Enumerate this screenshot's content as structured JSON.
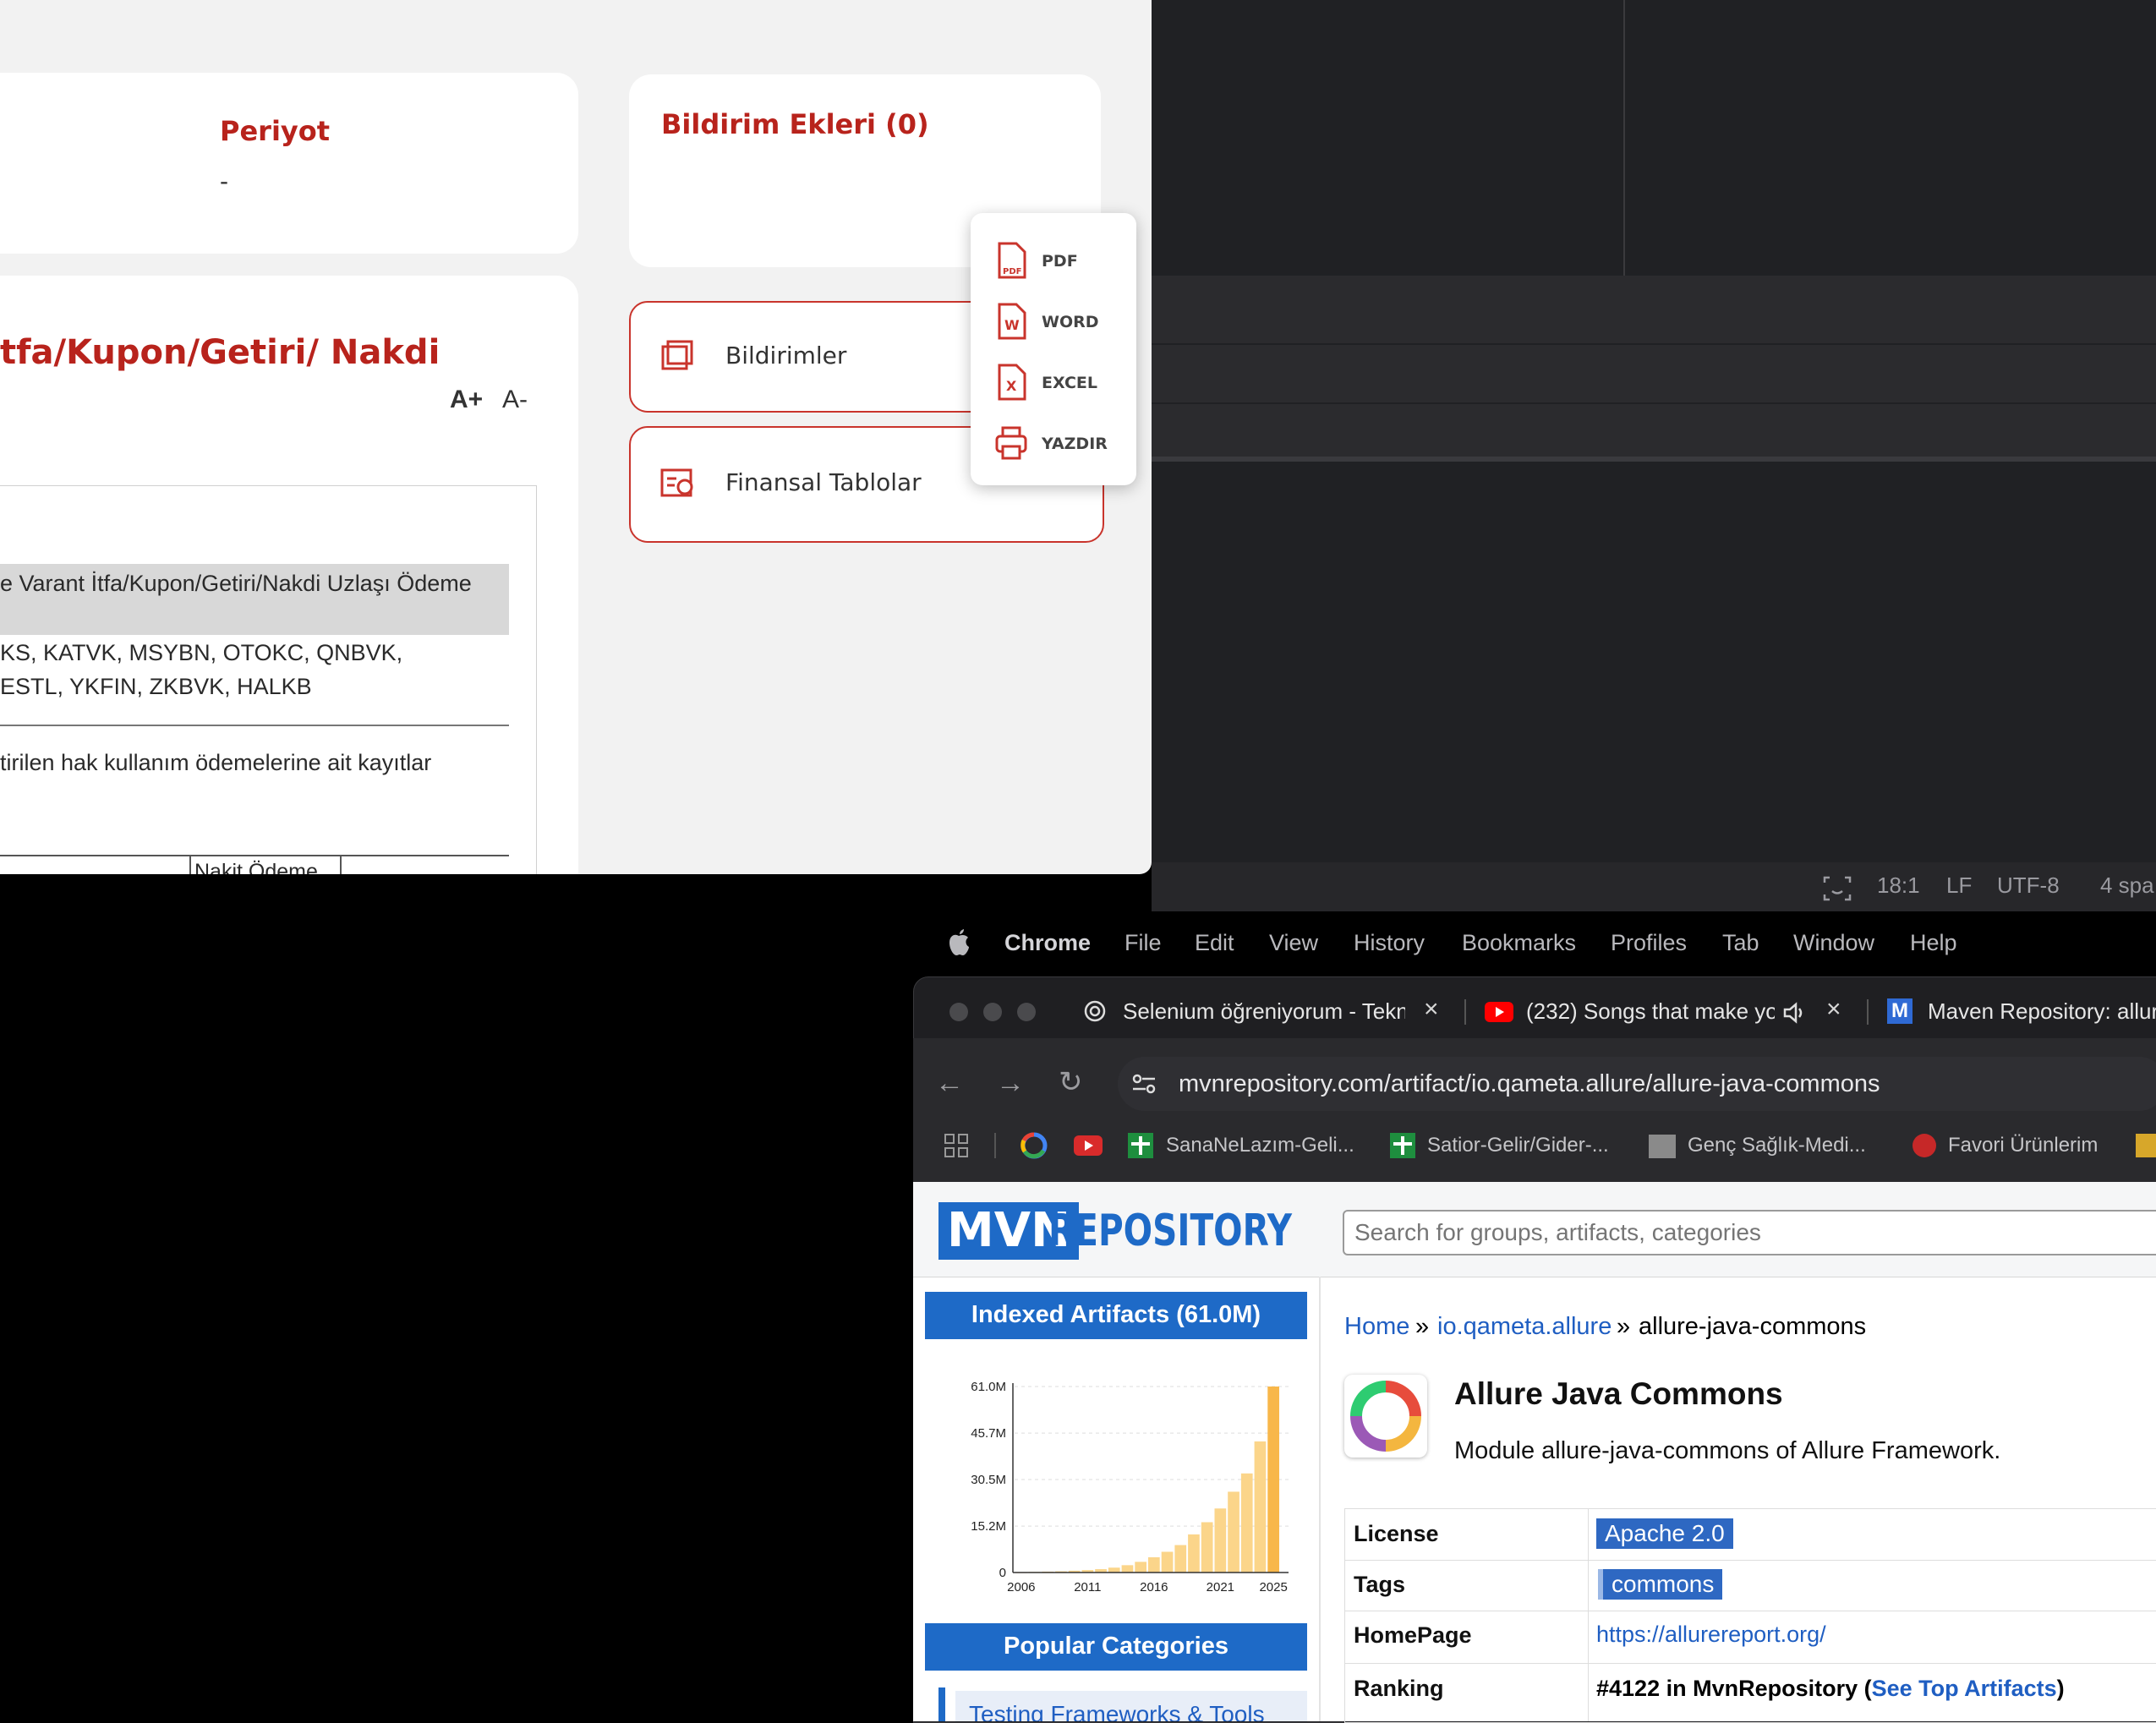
{
  "kap": {
    "period_title": "Periyot",
    "period_value": "-",
    "attachments_title": "Bildirim Ekleri (0)",
    "section_title": "tfa/Kupon/Getiri/ Nakdi",
    "font_plus": "A+",
    "font_minus": "A-",
    "notifications_btn": "Bildirimler",
    "financials_btn": "Finansal Tablolar",
    "doc_line1": "e Varant İtfa/Kupon/Getiri/Nakdi Uzlaşı Ödeme",
    "doc_line2": "KS, KATVK, MSYBN, OTOKC, QNBVK,",
    "doc_line3": "ESTL, YKFIN, ZKBVK, HALKB",
    "doc_line4": "tirilen hak kullanım ödemelerine ait kayıtlar",
    "doc_table_header": "Nakit Ödeme",
    "export": [
      "PDF",
      "WORD",
      "EXCEL",
      "YAZDIR"
    ],
    "accent": "#b8231c"
  },
  "editor_status": {
    "position": "18:1",
    "line_ending": "LF",
    "encoding": "UTF-8",
    "indent": "4 spa"
  },
  "menubar": [
    "Chrome",
    "File",
    "Edit",
    "View",
    "History",
    "Bookmarks",
    "Profiles",
    "Tab",
    "Window",
    "Help"
  ],
  "chrome": {
    "tabs": [
      {
        "title": "Selenium öğreniyorum - Tekni"
      },
      {
        "title": "(232) Songs that make yo"
      },
      {
        "title": "Maven Repository: allure"
      }
    ],
    "url": "mvnrepository.com/artifact/io.qameta.allure/allure-java-commons",
    "bookmarks": [
      "SanaNeLazım-Geli...",
      "Satior-Gelir/Gider-...",
      "Genç Sağlık-Medi...",
      "Favori Ürünlerim"
    ]
  },
  "mvn": {
    "logo_mvn": "MVN",
    "logo_repo": "REPOSITORY",
    "search_placeholder": "Search for groups, artifacts, categories",
    "indexed_title": "Indexed Artifacts (61.0M)",
    "popular_title": "Popular Categories",
    "popular_first": "Testing Frameworks & Tools",
    "breadcrumb": {
      "home": "Home",
      "sep1": "»",
      "group": "io.qameta.allure",
      "sep2": "»",
      "artifact": "allure-java-commons"
    },
    "artifact_title": "Allure Java Commons",
    "artifact_desc": "Module allure-java-commons of Allure Framework.",
    "info": {
      "license_key": "License",
      "license_val": "Apache 2.0",
      "tags_key": "Tags",
      "tags_val": "commons",
      "homepage_key": "HomePage",
      "homepage_val": "https://allurereport.org/",
      "ranking_key": "Ranking",
      "ranking_val": "#4122 in MvnRepository (",
      "ranking_link": "See Top Artifacts",
      "ranking_end": ")"
    },
    "brand_color": "#1e6ac7"
  },
  "chart_data": {
    "type": "bar",
    "x": [
      2006,
      2007,
      2008,
      2009,
      2010,
      2011,
      2012,
      2013,
      2014,
      2015,
      2016,
      2017,
      2018,
      2019,
      2020,
      2021,
      2022,
      2023,
      2024,
      2025
    ],
    "values": [
      0.1,
      0.2,
      0.3,
      0.4,
      0.6,
      0.8,
      1.1,
      1.6,
      2.4,
      3.5,
      5.0,
      6.8,
      9.0,
      12.5,
      16.5,
      21.0,
      26.5,
      32.5,
      43.0,
      61.0
    ],
    "ytick_labels": [
      "0",
      "15.2M",
      "30.5M",
      "45.7M",
      "61.0M"
    ],
    "yticks": [
      0,
      15.2,
      30.5,
      45.7,
      61.0
    ],
    "xtick_labels": [
      "2006",
      "2011",
      "2016",
      "2021",
      "2025"
    ],
    "ylim": [
      0,
      61.0
    ],
    "color": "#fbd58a",
    "last_color": "#f8b74a"
  }
}
